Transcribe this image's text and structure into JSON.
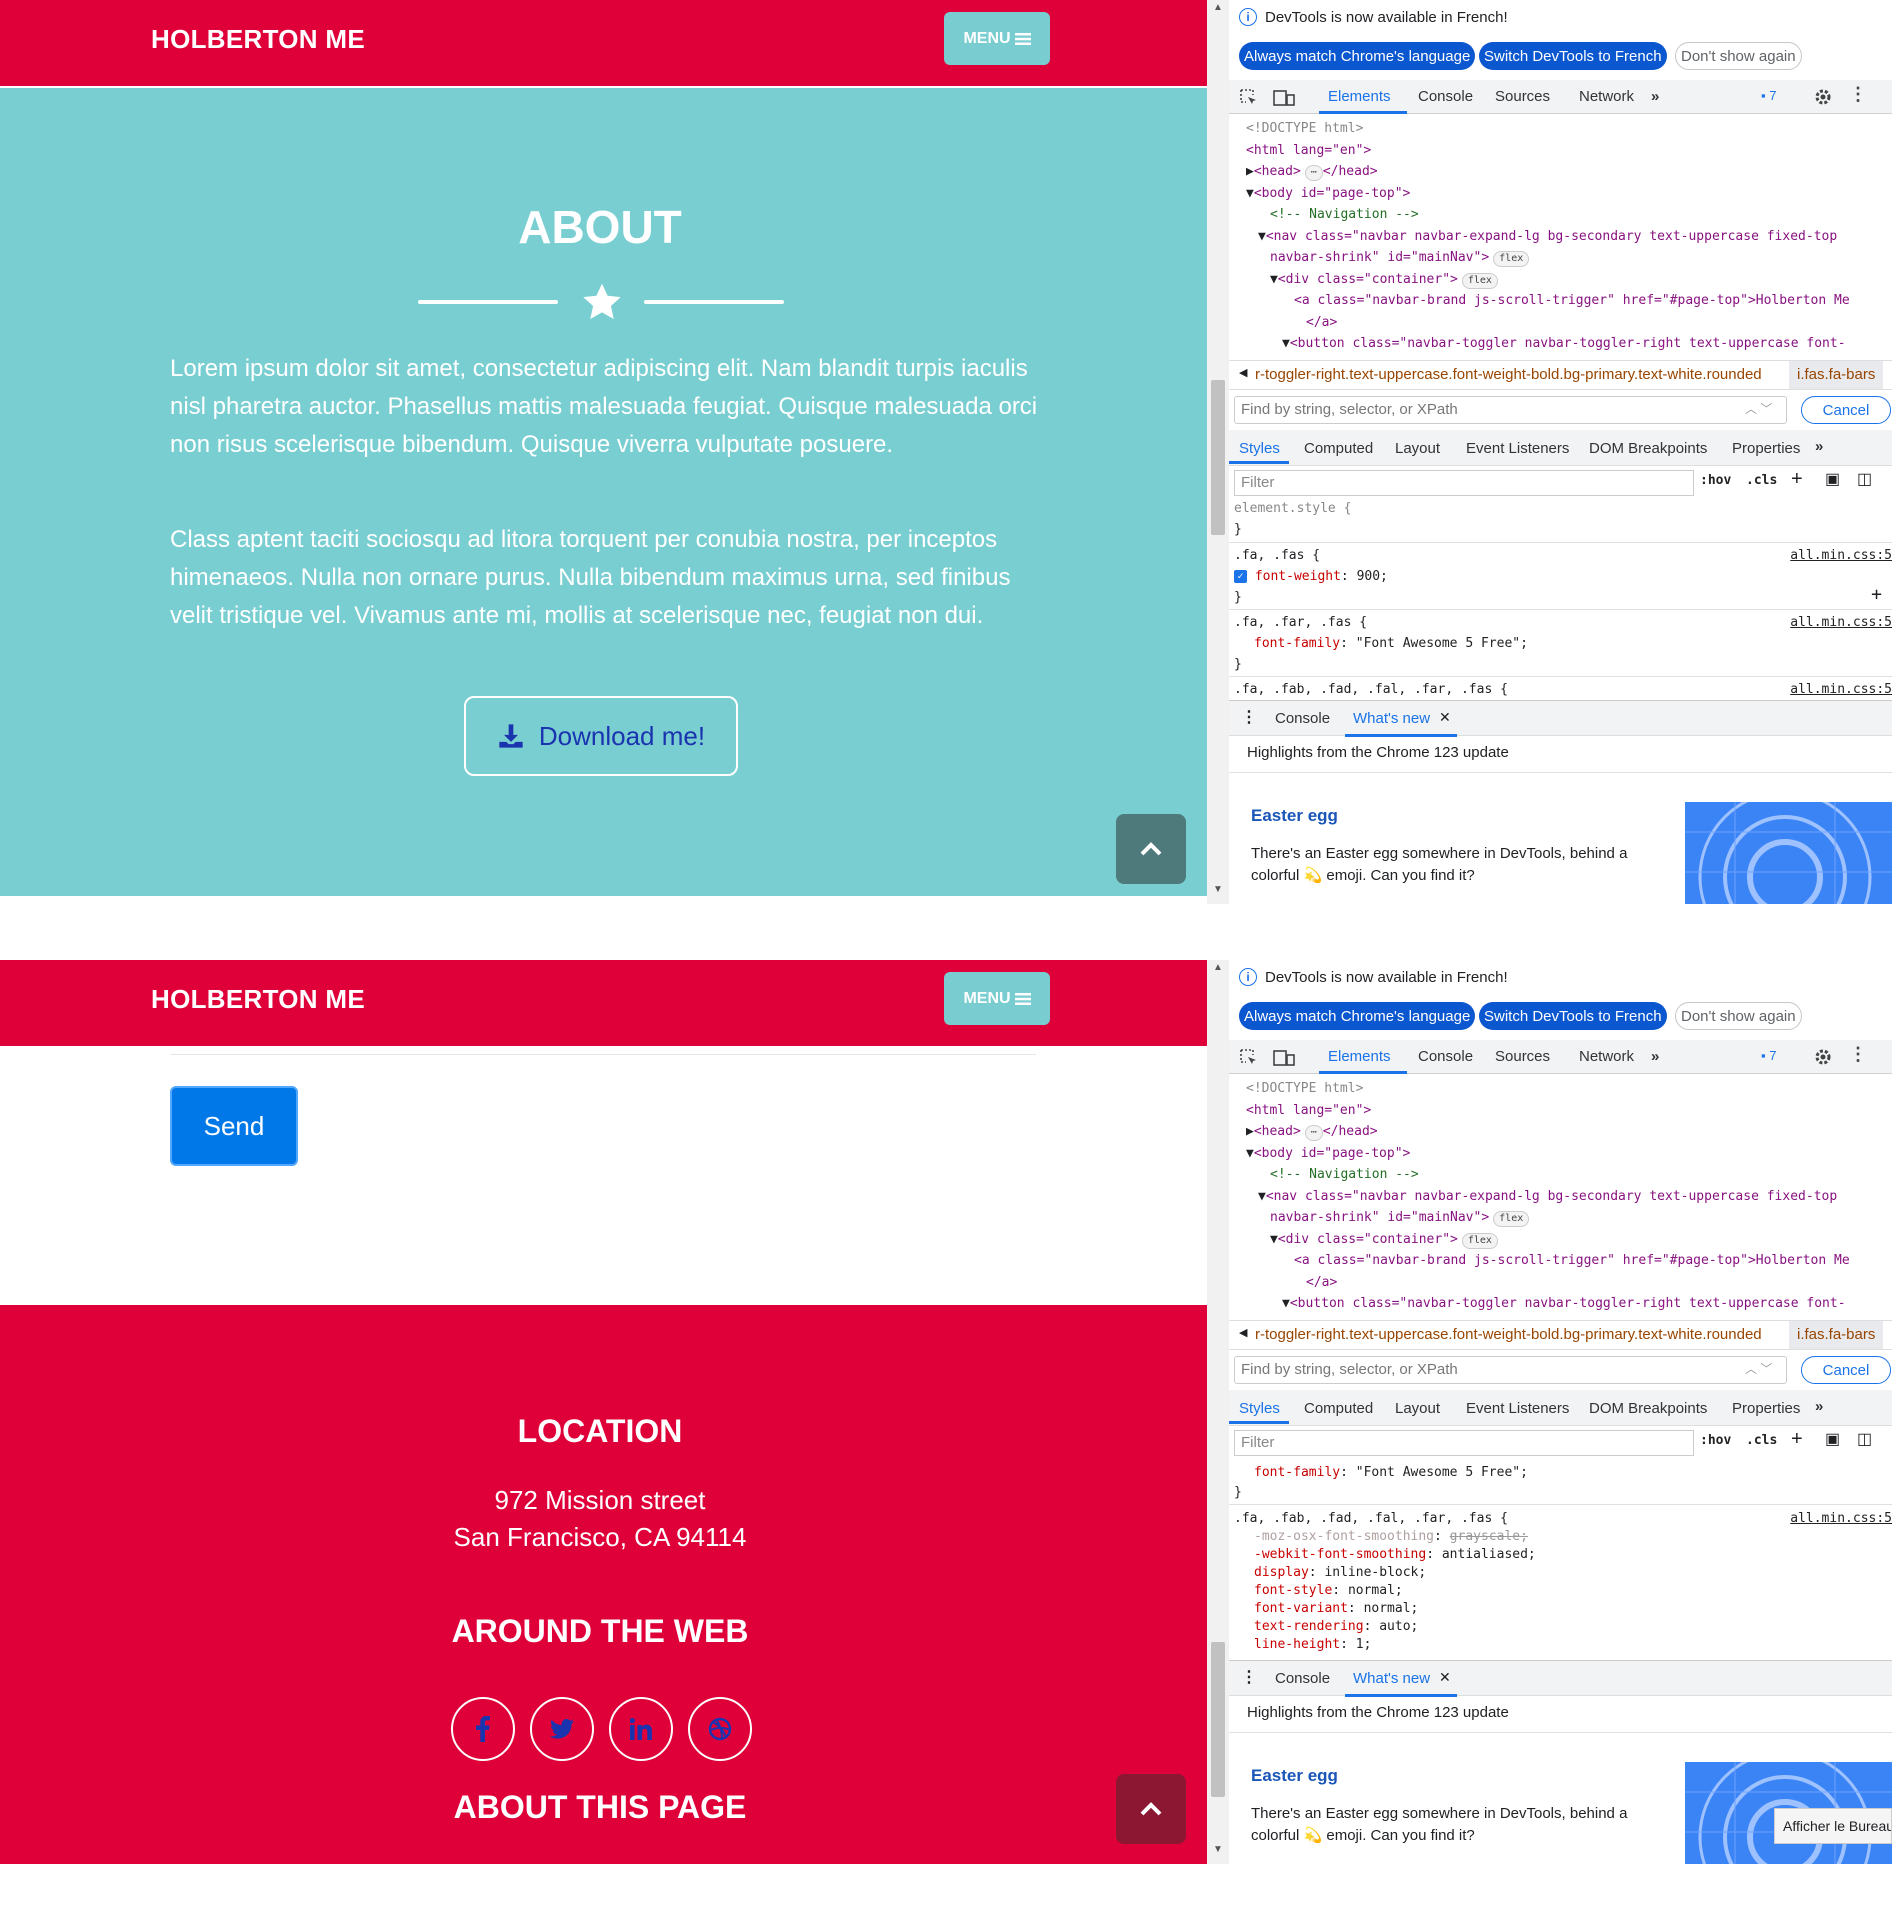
{
  "site": {
    "brand": "HOLBERTON ME",
    "menu_label": "MENU",
    "about_title": "ABOUT",
    "about_p1": "Lorem ipsum dolor sit amet, consectetur adipiscing elit. Nam blandit turpis iaculis nisl pharetra auctor. Phasellus mattis malesuada feugiat. Quisque malesuada orci non risus scelerisque bibendum. Quisque viverra vulputate posuere.",
    "about_p2": "Class aptent taciti sociosqu ad litora torquent per conubia nostra, per inceptos himenaeos. Nulla non ornare purus. Nulla bibendum maximus urna, sed finibus velit tristique vel. Vivamus ante mi, mollis at scelerisque nec, feugiat non dui.",
    "download_label": "Download me!",
    "send_label": "Send",
    "location_title": "LOCATION",
    "address_line1": "972 Mission street",
    "address_line2": "San Francisco, CA 94114",
    "around_web_title": "AROUND THE WEB",
    "about_page_title": "ABOUT THIS PAGE",
    "social": [
      "facebook",
      "twitter",
      "linkedin",
      "dribbble"
    ]
  },
  "devtools": {
    "info_text": "DevTools is now available in French!",
    "btn_match": "Always match Chrome's language",
    "btn_switch": "Switch DevTools to French",
    "btn_dont_show": "Don't show again",
    "tabs": [
      "Elements",
      "Console",
      "Sources",
      "Network"
    ],
    "issues_count": "7",
    "code_lines": {
      "doctype": "<!DOCTYPE html>",
      "html_open": "<html lang=\"en\">",
      "head": "<head>",
      "head_close": "</head>",
      "body_open": "<body id=\"page-top\">",
      "comment": "<!-- Navigation -->",
      "nav_line1": "<nav class=\"navbar navbar-expand-lg bg-secondary text-uppercase fixed-top",
      "nav_line2": "navbar-shrink\" id=\"mainNav\">",
      "div_container": "<div class=\"container\">",
      "a_brand": "<a class=\"navbar-brand js-scroll-trigger\" href=\"#page-top\">Holberton Me",
      "a_close": "</a>",
      "button_line": "<button class=\"navbar-toggler navbar-toggler-right text-uppercase font-"
    },
    "flex_badge": "flex",
    "breadcrumb_main": "r-toggler-right.text-uppercase.font-weight-bold.bg-primary.text-white.rounded",
    "breadcrumb_end": "i.fas.fa-bars",
    "find_placeholder": "Find by string, selector, or XPath",
    "cancel_label": "Cancel",
    "subtabs": [
      "Styles",
      "Computed",
      "Layout",
      "Event Listeners",
      "DOM Breakpoints",
      "Properties"
    ],
    "filter_placeholder": "Filter",
    "hov": ":hov",
    "cls": ".cls",
    "styles_1": {
      "element_style": "element.style {",
      "close": "}",
      "rule1_sel": ".fa, .fas {",
      "rule1_prop": "font-weight",
      "rule1_val": "900;",
      "source": "all.min.css:5",
      "rule2_sel": ".fa, .far, .fas {",
      "rule2_prop": "font-family",
      "rule2_val": "\"Font Awesome 5 Free\";",
      "rule3_sel": ".fa, .fab, .fad, .fal, .far, .fas {"
    },
    "styles_2": {
      "props": [
        {
          "p": "-moz-osx-font-smoothing",
          "v": "grayscale;",
          "struck": true
        },
        {
          "p": "-webkit-font-smoothing",
          "v": "antialiased;"
        },
        {
          "p": "display",
          "v": "inline-block;"
        },
        {
          "p": "font-style",
          "v": "normal;"
        },
        {
          "p": "font-variant",
          "v": "normal;"
        },
        {
          "p": "text-rendering",
          "v": "auto;"
        },
        {
          "p": "line-height",
          "v": "1;"
        }
      ]
    },
    "drawer_console": "Console",
    "drawer_whatsnew": "What's new",
    "highlights": "Highlights from the Chrome 123 update",
    "easter_title": "Easter egg",
    "easter_text": "There's an Easter egg somewhere in DevTools, behind a colorful 💫 emoji. Can you find it?",
    "tooltip": "Afficher le Bureau"
  },
  "colors": {
    "brand_red": "#df0039",
    "teal": "#79ced1",
    "send_blue": "#0078e8",
    "devtools_blue": "#1a73e8"
  }
}
